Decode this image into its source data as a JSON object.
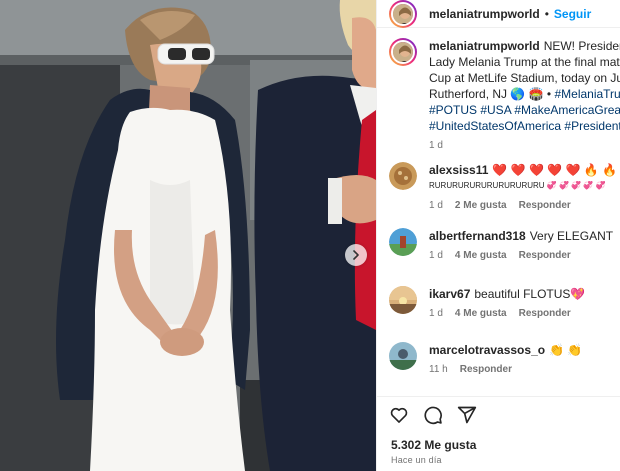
{
  "post": {
    "username": "melaniatrumpworld",
    "follow_label": "Seguir",
    "separator": "•"
  },
  "caption": {
    "username": "melaniatrumpworld",
    "line1": "NEW! President D",
    "line2": "Lady Melania Trump at the final match",
    "line3": "Cup at MetLife Stadium, today on July",
    "line4": "Rutherford, NJ 🌎 🏟️ •",
    "line4_link": "#MelaniaTrump",
    "line5": "#POTUS #USA #MakeAmericaGreatAg",
    "line6": "#UnitedStatesOfAmerica #President",
    "time": "1 d"
  },
  "comments": [
    {
      "username": "alexsiss11",
      "text": "❤️ ❤️ ❤️ ❤️ ❤️ 🔥 🔥 🔥 🔥",
      "text2": "RURURURURURURURURURU 💞 💞 💞 💞 💞",
      "time": "1 d",
      "likes": "2 Me gusta",
      "reply": "Responder"
    },
    {
      "username": "albertfernand318",
      "text": "Very ELEGANT",
      "time": "1 d",
      "likes": "4 Me gusta",
      "reply": "Responder"
    },
    {
      "username": "ikarv67",
      "text": "beautiful FLOTUS💖",
      "time": "1 d",
      "likes": "4 Me gusta",
      "reply": "Responder"
    },
    {
      "username": "marcelotravassos_o",
      "text": "👏 👏",
      "time": "11 h",
      "reply": "Responder"
    }
  ],
  "footer": {
    "likes": "5.302 Me gusta",
    "posted": "Hace un día"
  },
  "icons": {
    "like": "heart-icon",
    "comment": "comment-icon",
    "share": "share-icon",
    "next": "chevron-right-icon"
  },
  "colors": {
    "link_blue": "#0095f6",
    "hashtag": "#00376b",
    "muted": "#737373"
  }
}
